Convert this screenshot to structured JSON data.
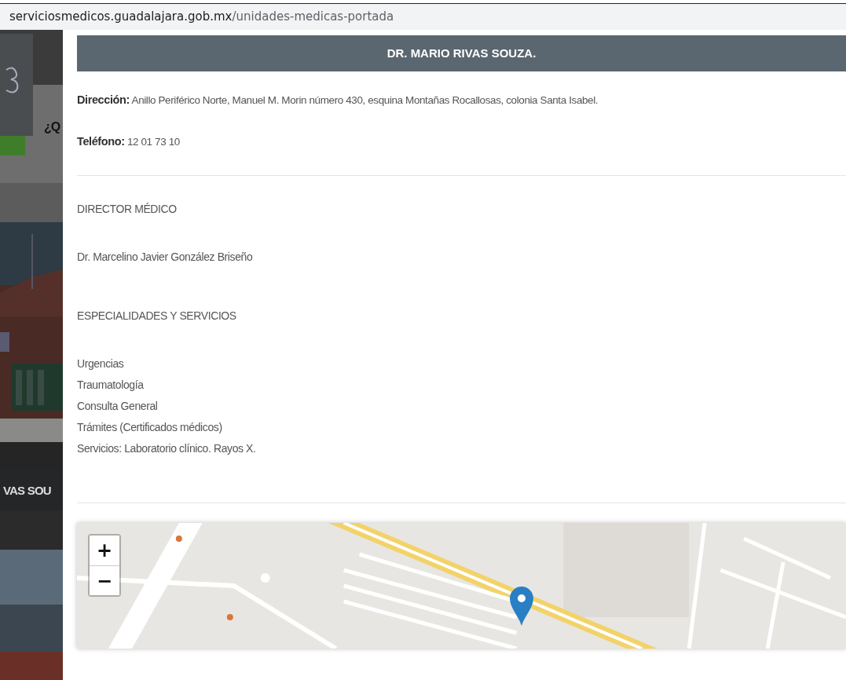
{
  "address_bar": {
    "domain": "serviciosmedicos.guadalajara.gob.mx",
    "path": "/unidades-medicas-portada"
  },
  "background_page": {
    "heading_fragment": "¿Q",
    "banner_fragment": "VAS SOU"
  },
  "modal": {
    "title": "DR. MARIO RIVAS SOUZA.",
    "fields": [
      {
        "label": "Dirección:",
        "value": "Anillo Periférico Norte, Manuel M. Morin número 430, esquina Montañas Rocallosas, colonia Santa Isabel."
      },
      {
        "label": "Teléfono:",
        "value": "12 01 73 10"
      }
    ],
    "sections": [
      {
        "heading": "DIRECTOR MÉDICO",
        "lines": [
          "Dr. Marcelino Javier González Briseño"
        ]
      },
      {
        "heading": "ESPECIALIDADES Y SERVICIOS",
        "lines": [
          "Urgencias",
          "Traumatología",
          "Consulta General",
          "Trámites (Certificados médicos)",
          "Servicios: Laboratorio clínico. Rayos X."
        ]
      }
    ],
    "map": {
      "zoom_in": "+",
      "zoom_out": "−"
    }
  }
}
